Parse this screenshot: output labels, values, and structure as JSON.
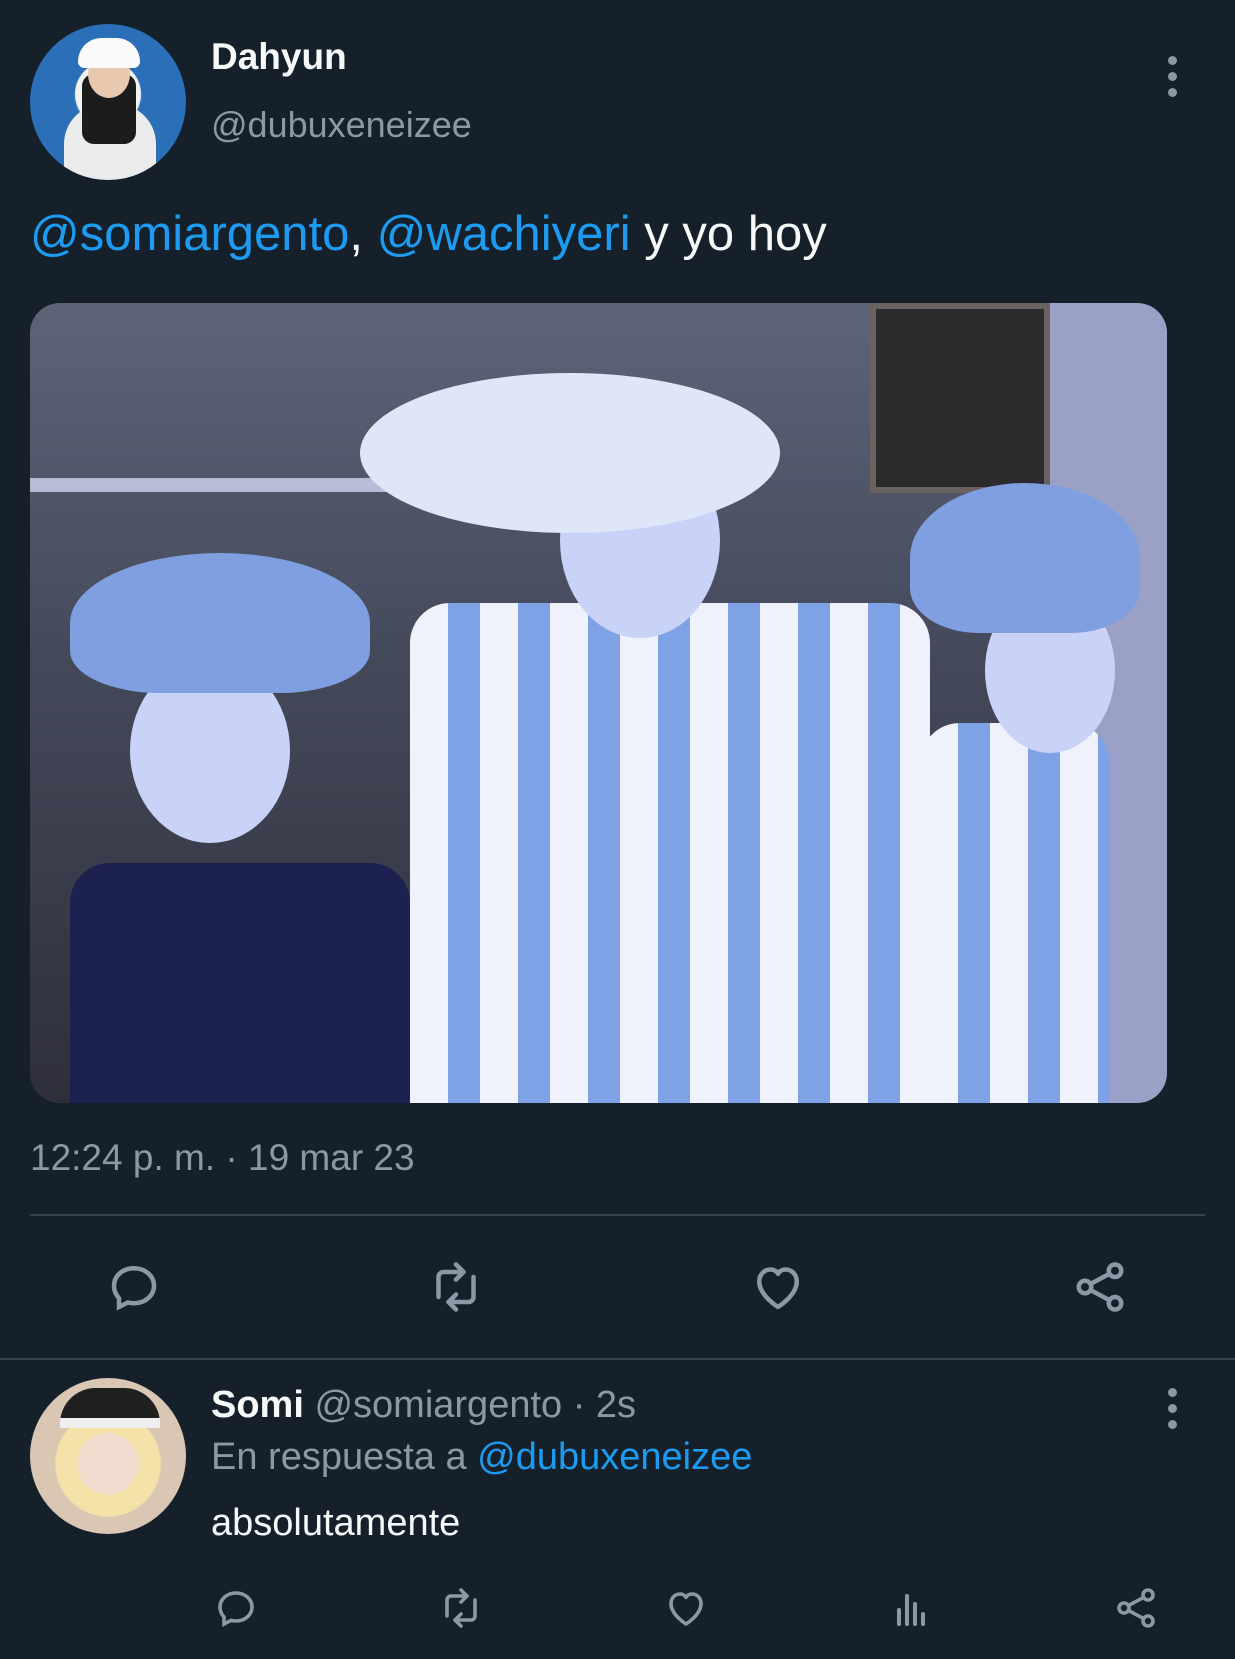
{
  "tweet": {
    "author_name": "Dahyun",
    "author_handle": "@dubuxeneizee",
    "text": {
      "mention_1": "@somiargento",
      "separator": ", ",
      "mention_2": "@wachiyeri",
      "rest": " y yo hoy"
    },
    "timestamp": "12:24 p. m. · 19 mar 23",
    "actions": [
      "reply-icon",
      "retweet-icon",
      "like-icon",
      "share-icon"
    ]
  },
  "reply": {
    "author_name": "Somi",
    "author_handle": " @somiargento · 2s",
    "in_reply_to_label": "En respuesta a ",
    "in_reply_to_handle": "@dubuxeneizee",
    "text": "absolutamente",
    "actions": [
      "reply-icon",
      "retweet-icon",
      "like-icon",
      "analytics-icon",
      "share-icon"
    ]
  },
  "colors": {
    "background": "#15202b",
    "accent": "#1d9bf0",
    "secondary_text": "#8b98a5",
    "divider": "#38444d"
  }
}
